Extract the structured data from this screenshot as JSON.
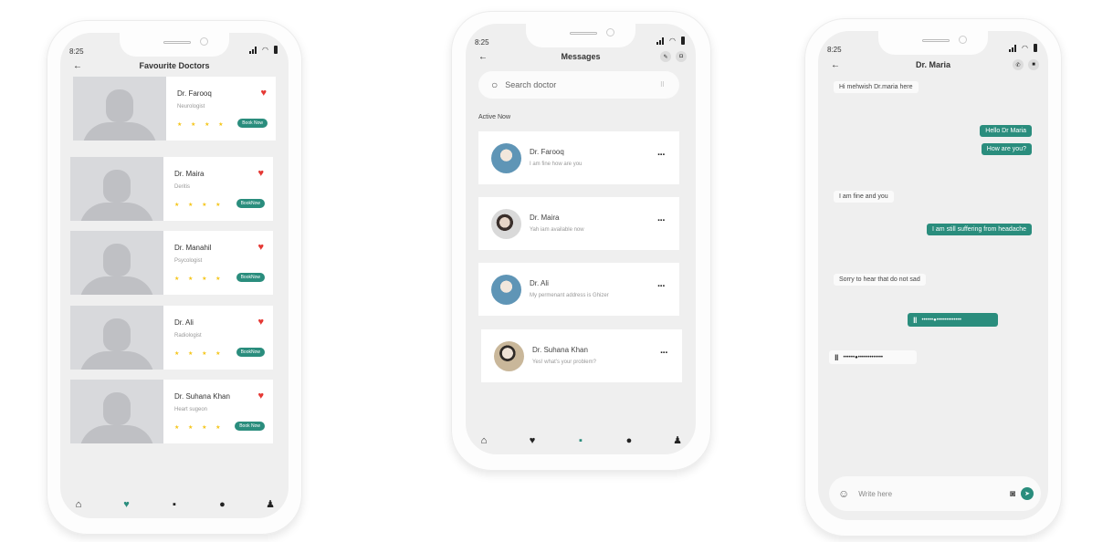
{
  "status_bar": {
    "time": "8:25"
  },
  "favourites_screen": {
    "title": "Favourite Doctors",
    "back_icon": "arrow-left-icon",
    "doctors": [
      {
        "name": "Dr. Farooq",
        "specialty": "Neurologist",
        "stars": "★ ★ ★ ★",
        "button": "Book Now"
      },
      {
        "name": "Dr. Maira",
        "specialty": "Deritis",
        "stars": "★ ★ ★ ★",
        "button": "BookNow"
      },
      {
        "name": "Dr. Manahil",
        "specialty": "Psycologist",
        "stars": "★ ★ ★ ★",
        "button": "BookNow"
      },
      {
        "name": "Dr. Ali",
        "specialty": "Radiologist",
        "stars": "★ ★ ★ ★",
        "button": "BookNow"
      },
      {
        "name": "Dr. Suhana Khan",
        "specialty": "Heart sugeon",
        "stars": "★ ★ ★ ★",
        "button": "Book Now"
      }
    ],
    "nav_active": "favourites"
  },
  "messages_screen": {
    "title": "Messages",
    "search_placeholder": "Search doctor",
    "section_label": "Active Now",
    "conversations": [
      {
        "name": "Dr. Farooq",
        "preview": "I am fine how are you"
      },
      {
        "name": "Dr. Maira",
        "preview": "Yah iam available now"
      },
      {
        "name": "Dr. Ali",
        "preview": "My permenant address is Ghizer"
      },
      {
        "name": "Dr. Suhana Khan",
        "preview": "Yes! what's your problem?"
      }
    ],
    "nav_active": "messages"
  },
  "chat_screen": {
    "title": "Dr. Maria",
    "messages": [
      {
        "from": "doctor",
        "text": "Hi mehwish Dr.maria here"
      },
      {
        "from": "me",
        "text": "Hello Dr Maria"
      },
      {
        "from": "me",
        "text": "How are you?"
      },
      {
        "from": "doctor",
        "text": "I am fine and you"
      },
      {
        "from": "me",
        "text": "I am still suffering from headache"
      },
      {
        "from": "doctor",
        "text": "Sorry to hear that do not sad"
      }
    ],
    "voice_wave": "••••••●•••••••••••••",
    "composer_placeholder": "Write here"
  },
  "colors": {
    "accent": "#2a8d7d",
    "heart": "#e53935",
    "star": "#f5c518"
  }
}
